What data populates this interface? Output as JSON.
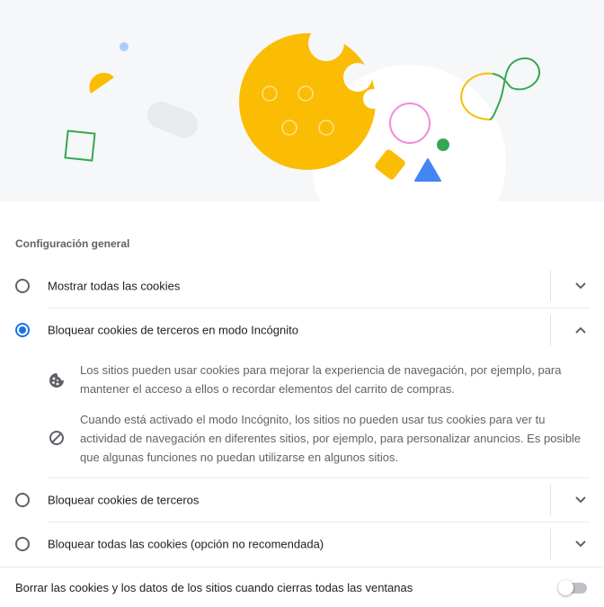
{
  "section": {
    "title": "Configuración general"
  },
  "options": [
    {
      "label": "Mostrar todas las cookies",
      "selected": false,
      "expanded": false,
      "icon": "chevron-down-icon"
    },
    {
      "label": "Bloquear cookies de terceros en modo Incógnito",
      "selected": true,
      "expanded": true,
      "icon": "chevron-up-icon"
    },
    {
      "label": "Bloquear cookies de terceros",
      "selected": false,
      "expanded": false,
      "icon": "chevron-down-icon"
    },
    {
      "label": "Bloquear todas las cookies (opción no recomendada)",
      "selected": false,
      "expanded": false,
      "icon": "chevron-down-icon"
    }
  ],
  "details": [
    {
      "icon": "cookie-icon",
      "text": "Los sitios pueden usar cookies para mejorar la experiencia de navegación, por ejemplo, para mantener el acceso a ellos o recordar elementos del carrito de compras."
    },
    {
      "icon": "block-icon",
      "text": "Cuando está activado el modo Incógnito, los sitios no pueden usar tus cookies para ver tu actividad de navegación en diferentes sitios, por ejemplo, para personalizar anuncios. Es posible que algunas funciones no puedan utilizarse en algunos sitios."
    }
  ],
  "footer": {
    "label": "Borrar las cookies y los datos de los sitios cuando cierras todas las ventanas",
    "toggle_on": false
  },
  "colors": {
    "accent": "#1a73e8",
    "cookie": "#fbbc04",
    "green": "#34a853",
    "pink": "#f28bdc",
    "blue": "#4285f4",
    "hero_bg": "#f6f7f9"
  }
}
